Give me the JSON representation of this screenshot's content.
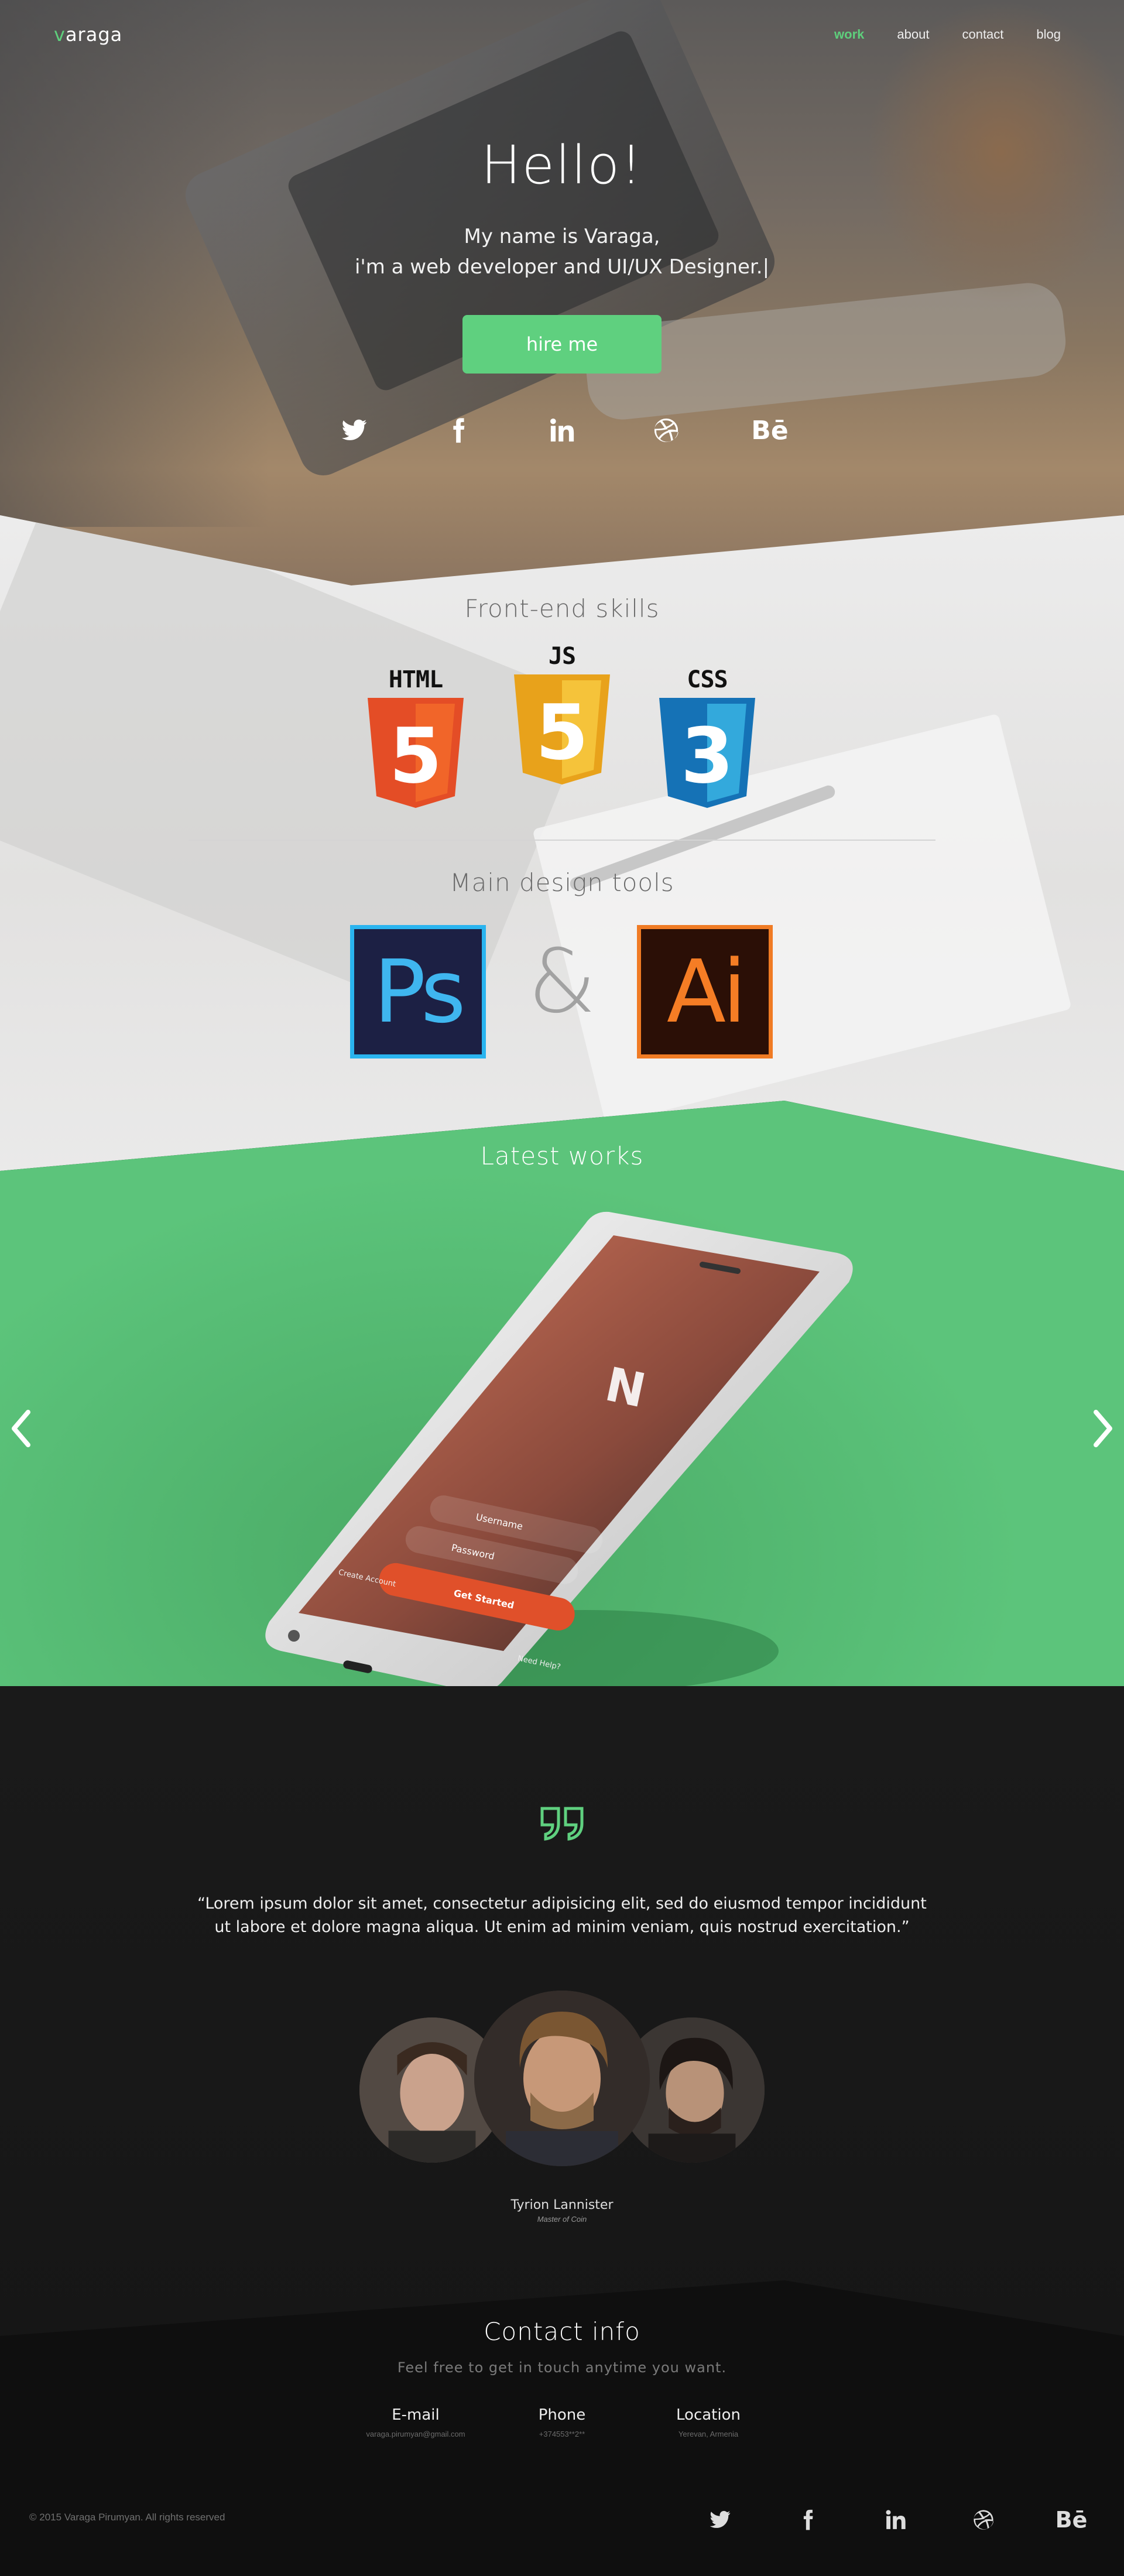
{
  "brand": {
    "logo_accent": "v",
    "logo_rest": "araga",
    "accent_color": "#5fd07f"
  },
  "nav": {
    "items": [
      {
        "label": "work",
        "active": true
      },
      {
        "label": "about",
        "active": false
      },
      {
        "label": "contact",
        "active": false
      },
      {
        "label": "blog",
        "active": false
      }
    ]
  },
  "hero": {
    "title": "Hello!",
    "line1": "My name is Varaga,",
    "line2": "i'm a web developer and UI/UX Designer.|",
    "cta": "hire me",
    "social": [
      "twitter-icon",
      "facebook-icon",
      "linkedin-icon",
      "dribbble-icon",
      "behance-icon"
    ],
    "behance_text": "Bē"
  },
  "skills": {
    "frontend_title": "Front-end skills",
    "badges": [
      {
        "caption": "HTML",
        "number": "5",
        "color": "#e44d26",
        "dark": "#f16529"
      },
      {
        "caption": "JS",
        "number": "5",
        "color": "#e8a21b",
        "dark": "#f5c33a"
      },
      {
        "caption": "CSS",
        "number": "3",
        "color": "#1572b6",
        "dark": "#33a9dc"
      }
    ],
    "design_title": "Main design tools",
    "tools": [
      {
        "label": "Ps"
      },
      {
        "label": "Ai"
      }
    ],
    "ampersand": "&"
  },
  "works": {
    "title": "Latest works",
    "phone_screen": {
      "username": "Username",
      "password": "Password",
      "cta": "Get Started",
      "create": "Create Account",
      "help": "Need Help?"
    }
  },
  "testimonial": {
    "quote": "“Lorem ipsum dolor sit amet, consectetur adipisicing elit, sed do eiusmod tempor incididunt ut labore et dolore magna aliqua. Ut enim ad minim veniam, quis nostrud exercitation.”",
    "name": "Tyrion Lannister",
    "role": "Master of Coin"
  },
  "contact": {
    "title": "Contact info",
    "subtitle": "Feel free to get in touch anytime you want.",
    "email": {
      "label": "E-mail",
      "value": "varaga.pirumyan@gmail.com"
    },
    "phone": {
      "label": "Phone",
      "value": "+374553**2**"
    },
    "location": {
      "label": "Location",
      "value": "Yerevan, Armenia"
    }
  },
  "footer": {
    "copyright": "© 2015 Varaga Pirumyan. All rights reserved"
  }
}
